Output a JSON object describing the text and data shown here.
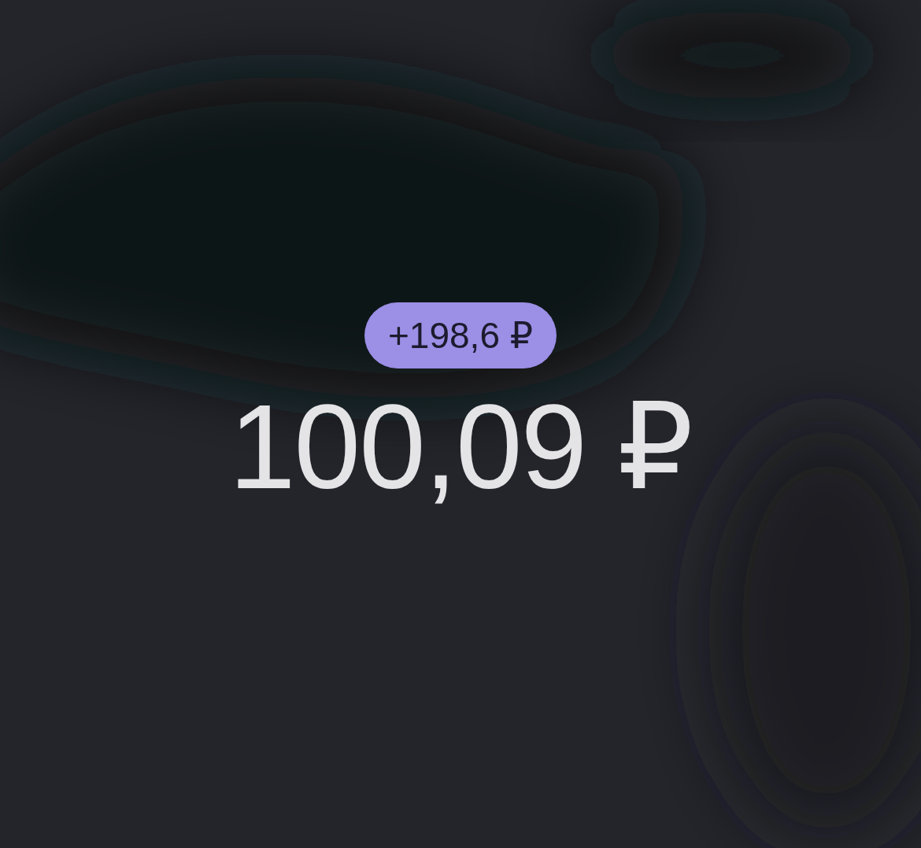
{
  "change_badge": {
    "text": "+198,6 ₽"
  },
  "balance": {
    "text": "100,09 ₽"
  }
}
